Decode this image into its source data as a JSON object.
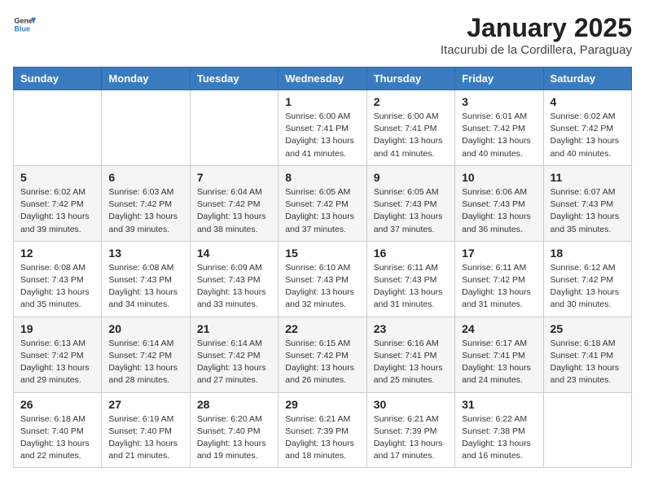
{
  "header": {
    "logo_general": "General",
    "logo_blue": "Blue",
    "month_title": "January 2025",
    "location": "Itacurubi de la Cordillera, Paraguay"
  },
  "weekdays": [
    "Sunday",
    "Monday",
    "Tuesday",
    "Wednesday",
    "Thursday",
    "Friday",
    "Saturday"
  ],
  "weeks": [
    [
      {
        "day": "",
        "info": ""
      },
      {
        "day": "",
        "info": ""
      },
      {
        "day": "",
        "info": ""
      },
      {
        "day": "1",
        "info": "Sunrise: 6:00 AM\nSunset: 7:41 PM\nDaylight: 13 hours and 41 minutes."
      },
      {
        "day": "2",
        "info": "Sunrise: 6:00 AM\nSunset: 7:41 PM\nDaylight: 13 hours and 41 minutes."
      },
      {
        "day": "3",
        "info": "Sunrise: 6:01 AM\nSunset: 7:42 PM\nDaylight: 13 hours and 40 minutes."
      },
      {
        "day": "4",
        "info": "Sunrise: 6:02 AM\nSunset: 7:42 PM\nDaylight: 13 hours and 40 minutes."
      }
    ],
    [
      {
        "day": "5",
        "info": "Sunrise: 6:02 AM\nSunset: 7:42 PM\nDaylight: 13 hours and 39 minutes."
      },
      {
        "day": "6",
        "info": "Sunrise: 6:03 AM\nSunset: 7:42 PM\nDaylight: 13 hours and 39 minutes."
      },
      {
        "day": "7",
        "info": "Sunrise: 6:04 AM\nSunset: 7:42 PM\nDaylight: 13 hours and 38 minutes."
      },
      {
        "day": "8",
        "info": "Sunrise: 6:05 AM\nSunset: 7:42 PM\nDaylight: 13 hours and 37 minutes."
      },
      {
        "day": "9",
        "info": "Sunrise: 6:05 AM\nSunset: 7:43 PM\nDaylight: 13 hours and 37 minutes."
      },
      {
        "day": "10",
        "info": "Sunrise: 6:06 AM\nSunset: 7:43 PM\nDaylight: 13 hours and 36 minutes."
      },
      {
        "day": "11",
        "info": "Sunrise: 6:07 AM\nSunset: 7:43 PM\nDaylight: 13 hours and 35 minutes."
      }
    ],
    [
      {
        "day": "12",
        "info": "Sunrise: 6:08 AM\nSunset: 7:43 PM\nDaylight: 13 hours and 35 minutes."
      },
      {
        "day": "13",
        "info": "Sunrise: 6:08 AM\nSunset: 7:43 PM\nDaylight: 13 hours and 34 minutes."
      },
      {
        "day": "14",
        "info": "Sunrise: 6:09 AM\nSunset: 7:43 PM\nDaylight: 13 hours and 33 minutes."
      },
      {
        "day": "15",
        "info": "Sunrise: 6:10 AM\nSunset: 7:43 PM\nDaylight: 13 hours and 32 minutes."
      },
      {
        "day": "16",
        "info": "Sunrise: 6:11 AM\nSunset: 7:43 PM\nDaylight: 13 hours and 31 minutes."
      },
      {
        "day": "17",
        "info": "Sunrise: 6:11 AM\nSunset: 7:42 PM\nDaylight: 13 hours and 31 minutes."
      },
      {
        "day": "18",
        "info": "Sunrise: 6:12 AM\nSunset: 7:42 PM\nDaylight: 13 hours and 30 minutes."
      }
    ],
    [
      {
        "day": "19",
        "info": "Sunrise: 6:13 AM\nSunset: 7:42 PM\nDaylight: 13 hours and 29 minutes."
      },
      {
        "day": "20",
        "info": "Sunrise: 6:14 AM\nSunset: 7:42 PM\nDaylight: 13 hours and 28 minutes."
      },
      {
        "day": "21",
        "info": "Sunrise: 6:14 AM\nSunset: 7:42 PM\nDaylight: 13 hours and 27 minutes."
      },
      {
        "day": "22",
        "info": "Sunrise: 6:15 AM\nSunset: 7:42 PM\nDaylight: 13 hours and 26 minutes."
      },
      {
        "day": "23",
        "info": "Sunrise: 6:16 AM\nSunset: 7:41 PM\nDaylight: 13 hours and 25 minutes."
      },
      {
        "day": "24",
        "info": "Sunrise: 6:17 AM\nSunset: 7:41 PM\nDaylight: 13 hours and 24 minutes."
      },
      {
        "day": "25",
        "info": "Sunrise: 6:18 AM\nSunset: 7:41 PM\nDaylight: 13 hours and 23 minutes."
      }
    ],
    [
      {
        "day": "26",
        "info": "Sunrise: 6:18 AM\nSunset: 7:40 PM\nDaylight: 13 hours and 22 minutes."
      },
      {
        "day": "27",
        "info": "Sunrise: 6:19 AM\nSunset: 7:40 PM\nDaylight: 13 hours and 21 minutes."
      },
      {
        "day": "28",
        "info": "Sunrise: 6:20 AM\nSunset: 7:40 PM\nDaylight: 13 hours and 19 minutes."
      },
      {
        "day": "29",
        "info": "Sunrise: 6:21 AM\nSunset: 7:39 PM\nDaylight: 13 hours and 18 minutes."
      },
      {
        "day": "30",
        "info": "Sunrise: 6:21 AM\nSunset: 7:39 PM\nDaylight: 13 hours and 17 minutes."
      },
      {
        "day": "31",
        "info": "Sunrise: 6:22 AM\nSunset: 7:38 PM\nDaylight: 13 hours and 16 minutes."
      },
      {
        "day": "",
        "info": ""
      }
    ]
  ]
}
